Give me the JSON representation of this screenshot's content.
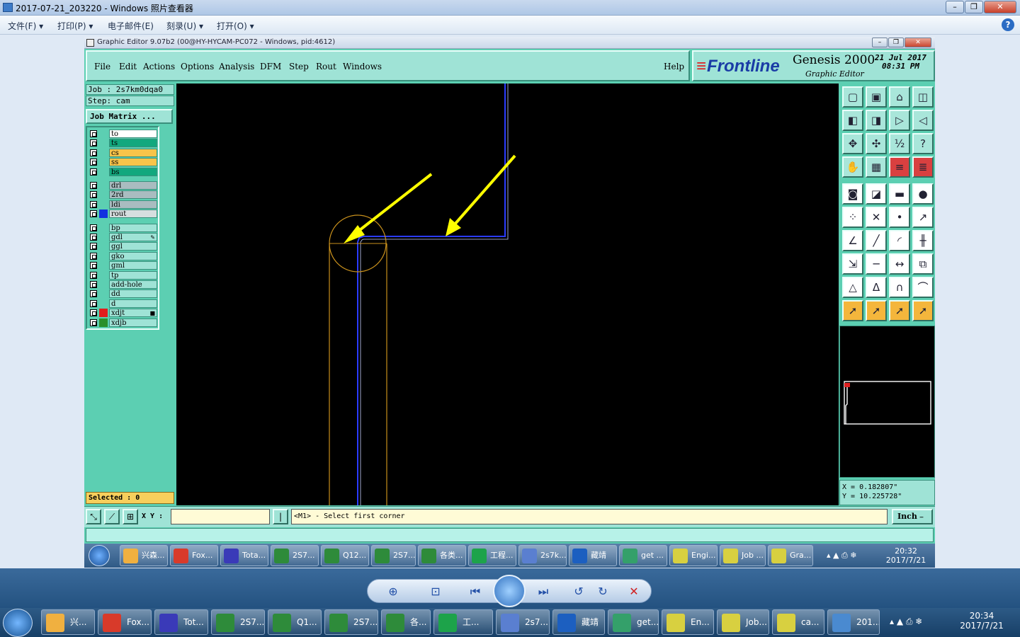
{
  "viewer": {
    "title": "2017-07-21_203220 - Windows 照片查看器",
    "menu": [
      "文件(F)",
      "打印(P)",
      "电子邮件(E)",
      "刻录(U)",
      "打开(O)"
    ],
    "help": "?"
  },
  "genesis": {
    "window_title": "Graphic Editor 9.07b2 (00@HY-HYCAM-PC072 - Windows, pid:4612)",
    "menu": [
      "File",
      "Edit",
      "Actions",
      "Options",
      "Analysis",
      "DFM",
      "Step",
      "Rout",
      "Windows"
    ],
    "help": "Help",
    "brand": "Frontline",
    "product": "Genesis 2000",
    "product_sub": "Graphic Editor",
    "date": "21 Jul 2017",
    "time": "08:31 PM",
    "job": "Job : 2s7km0dqa0",
    "step": "Step: cam",
    "job_matrix": "Job Matrix ...",
    "layers": [
      {
        "name": "to",
        "color": "#ffffff",
        "swatch": "",
        "mark": ""
      },
      {
        "name": "ts",
        "color": "#12a87e",
        "swatch": "",
        "mark": ""
      },
      {
        "name": "cs",
        "color": "#f8c44a",
        "swatch": "",
        "mark": ""
      },
      {
        "name": "ss",
        "color": "#f8c44a",
        "swatch": "",
        "mark": ""
      },
      {
        "name": "bs",
        "color": "#12a87e",
        "swatch": "",
        "mark": ""
      },
      {
        "name": "drl",
        "color": "#a9bcc0",
        "swatch": "",
        "mark": ""
      },
      {
        "name": "2rd",
        "color": "#a9bcc0",
        "swatch": "",
        "mark": ""
      },
      {
        "name": "ldi",
        "color": "#a9bcc0",
        "swatch": "",
        "mark": ""
      },
      {
        "name": "rout",
        "color": "#d6dedf",
        "swatch": "#1232e0",
        "mark": ""
      },
      {
        "name": "bp",
        "color": "#9fe3d6",
        "swatch": "",
        "mark": ""
      },
      {
        "name": "gdl",
        "color": "#9fe3d6",
        "swatch": "",
        "mark": "✎"
      },
      {
        "name": "ggl",
        "color": "#9fe3d6",
        "swatch": "",
        "mark": ""
      },
      {
        "name": "gko",
        "color": "#9fe3d6",
        "swatch": "",
        "mark": ""
      },
      {
        "name": "gml",
        "color": "#9fe3d6",
        "swatch": "",
        "mark": ""
      },
      {
        "name": "tp",
        "color": "#9fe3d6",
        "swatch": "",
        "mark": ""
      },
      {
        "name": "add-hole",
        "color": "#9fe3d6",
        "swatch": "",
        "mark": ""
      },
      {
        "name": "dd",
        "color": "#9fe3d6",
        "swatch": "",
        "mark": ""
      },
      {
        "name": "d",
        "color": "#9fe3d6",
        "swatch": "",
        "mark": ""
      },
      {
        "name": "xdjt",
        "color": "#9fe3d6",
        "swatch": "#e21c1c",
        "mark": "■"
      },
      {
        "name": "xdjb",
        "color": "#9fe3d6",
        "swatch": "#2a8f2a",
        "mark": ""
      }
    ],
    "selected": "Selected : 0",
    "coord_x": "X  =  0.182807\"",
    "coord_y": "Y  =  10.225728\"",
    "xy_label": "X Y :",
    "xy_value": "",
    "prompt": "<M1> - Select first corner",
    "unit": "Inch"
  },
  "inner_taskbar": {
    "items": [
      {
        "label": "兴森...",
        "icon": "shell-icon",
        "color": "#f0b040"
      },
      {
        "label": "Fox...",
        "icon": "foxit-icon",
        "color": "#d83a2a"
      },
      {
        "label": "Tota...",
        "icon": "floppy-icon",
        "color": "#3a3ab8"
      },
      {
        "label": "2S7...",
        "icon": "excel-icon",
        "color": "#2e8b3a"
      },
      {
        "label": "Q12...",
        "icon": "excel-icon",
        "color": "#2e8b3a"
      },
      {
        "label": "2S7...",
        "icon": "excel-icon",
        "color": "#2e8b3a"
      },
      {
        "label": "各类...",
        "icon": "excel-icon",
        "color": "#2e8b3a"
      },
      {
        "label": "工程...",
        "icon": "fp-icon",
        "color": "#1da34a"
      },
      {
        "label": "2s7k...",
        "icon": "doc-icon",
        "color": "#5a7fd0"
      },
      {
        "label": "藏靖",
        "icon": "frontline-icon",
        "color": "#1c5fc0"
      },
      {
        "label": "get ...",
        "icon": "eye-icon",
        "color": "#34a06a"
      },
      {
        "label": "Engi...",
        "icon": "x-window-icon",
        "color": "#d8d040"
      },
      {
        "label": "Job ...",
        "icon": "x-window-icon",
        "color": "#d8d040"
      },
      {
        "label": "Gra...",
        "icon": "x-window-icon",
        "color": "#d8d040"
      }
    ],
    "time": "20:32",
    "date": "2017/7/21"
  },
  "outer_taskbar": {
    "items": [
      {
        "label": "兴...",
        "icon": "shell-icon",
        "color": "#f0b040"
      },
      {
        "label": "Fox...",
        "icon": "foxit-icon",
        "color": "#d83a2a"
      },
      {
        "label": "Tot...",
        "icon": "floppy-icon",
        "color": "#3a3ab8"
      },
      {
        "label": "2S7...",
        "icon": "excel-icon",
        "color": "#2e8b3a"
      },
      {
        "label": "Q1...",
        "icon": "excel-icon",
        "color": "#2e8b3a"
      },
      {
        "label": "2S7...",
        "icon": "excel-icon",
        "color": "#2e8b3a"
      },
      {
        "label": "各...",
        "icon": "excel-icon",
        "color": "#2e8b3a"
      },
      {
        "label": "工...",
        "icon": "fp-icon",
        "color": "#1da34a"
      },
      {
        "label": "2s7...",
        "icon": "doc-icon",
        "color": "#5a7fd0"
      },
      {
        "label": "藏靖",
        "icon": "frontline-icon",
        "color": "#1c5fc0"
      },
      {
        "label": "get...",
        "icon": "eye-icon",
        "color": "#34a06a"
      },
      {
        "label": "En...",
        "icon": "x-window-icon",
        "color": "#d8d040"
      },
      {
        "label": "Job...",
        "icon": "x-window-icon",
        "color": "#d8d040"
      },
      {
        "label": "ca...",
        "icon": "x-window-icon",
        "color": "#d8d040"
      },
      {
        "label": "201...",
        "icon": "photo-viewer-icon",
        "color": "#4a8ad0"
      }
    ],
    "time": "20:34",
    "date": "2017/7/21"
  },
  "colors": {
    "canvas": "#000000",
    "rout": "#2b3cff",
    "outline": "#c8901c",
    "arrow": "#ffff00",
    "panel": "#5ccfb2"
  }
}
